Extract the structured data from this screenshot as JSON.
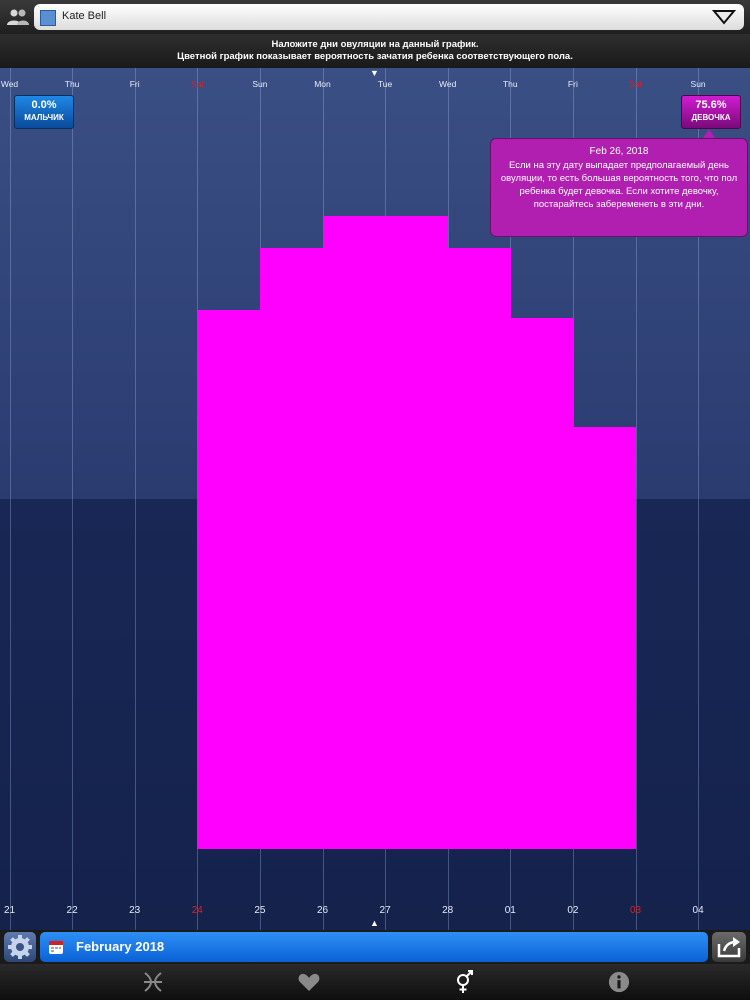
{
  "header": {
    "profile_name": "Kate Bell",
    "instructions_line1": "Наложите дни овуляции на данный график.",
    "instructions_line2": "Цветной график показывает вероятность зачатия ребенка соответствующего пола."
  },
  "chart": {
    "weekdays": [
      "Wed",
      "Thu",
      "Fri",
      "Sat",
      "Sun",
      "Mon",
      "Tue",
      "Wed",
      "Thu",
      "Fri",
      "Sat",
      "Sun"
    ],
    "dates": [
      "21",
      "22",
      "23",
      "24",
      "25",
      "26",
      "27",
      "28",
      "01",
      "02",
      "03",
      "04"
    ],
    "weekend_indices": [
      3,
      10
    ],
    "boy_badge": {
      "value": "0.0%",
      "label": "МАЛЬЧИК"
    },
    "girl_badge": {
      "value": "75.6%",
      "label": "ДЕВОЧКА"
    },
    "tooltip": {
      "date": "Feb 26, 2018",
      "text": "Если на эту дату выпадает предполагаемый день овуляции, то есть большая вероятность того, что пол ребенка будет девочка. Если хотите девочку, постарайтесь забеременеть в эти дни."
    }
  },
  "chart_data": {
    "type": "bar",
    "categories": [
      "21",
      "22",
      "23",
      "24",
      "25",
      "26",
      "27",
      "28",
      "01",
      "02",
      "03",
      "04"
    ],
    "values": [
      0,
      0,
      0,
      0.69,
      0.77,
      0.81,
      0.81,
      0.77,
      0.68,
      0.54,
      0,
      0
    ],
    "ylim": [
      0,
      1
    ],
    "bar_color": "#ff00ff"
  },
  "footer": {
    "month_label": "February 2018"
  },
  "colors": {
    "girl": "#ff00ff",
    "boy": "#1f88e6",
    "accent": "#0a6fe6"
  }
}
